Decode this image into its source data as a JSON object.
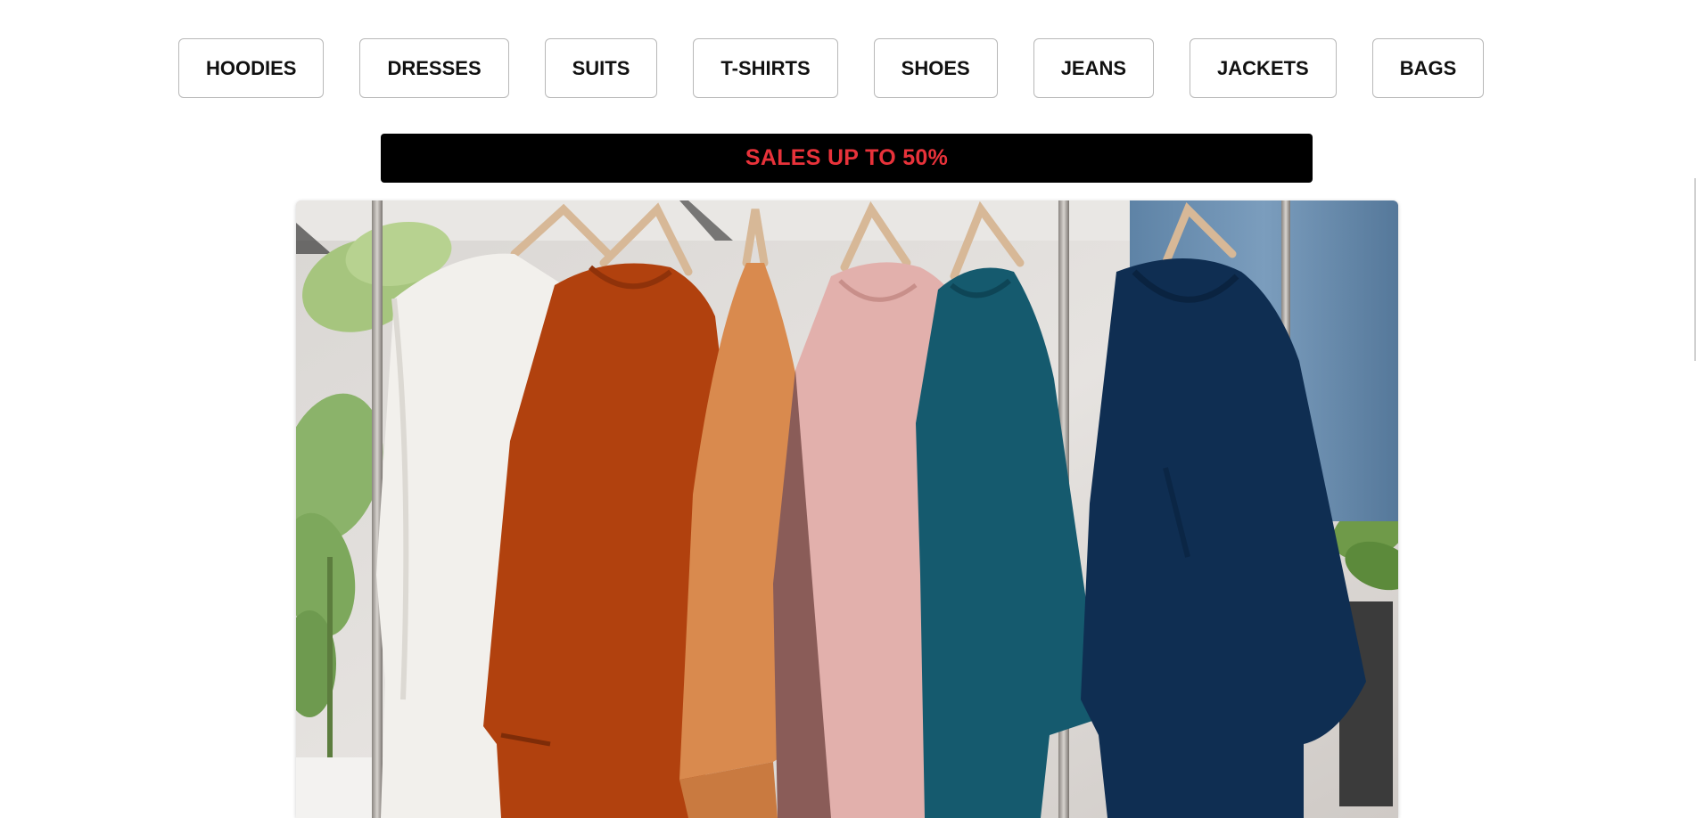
{
  "categories": [
    {
      "label": "HOODIES"
    },
    {
      "label": "DRESSES"
    },
    {
      "label": "SUITS"
    },
    {
      "label": "T-SHIRTS"
    },
    {
      "label": "SHOES"
    },
    {
      "label": "JEANS"
    },
    {
      "label": "JACKETS"
    },
    {
      "label": "BAGS"
    }
  ],
  "banner": {
    "text": "SALES UP TO 50%",
    "background_color": "#000000",
    "text_color": "#e8323a"
  },
  "hero": {
    "shirt_colors": [
      "#f2f0ec",
      "#b1410e",
      "#d98a4e",
      "#e2b0ac",
      "#155a6e",
      "#0f2e52"
    ]
  }
}
